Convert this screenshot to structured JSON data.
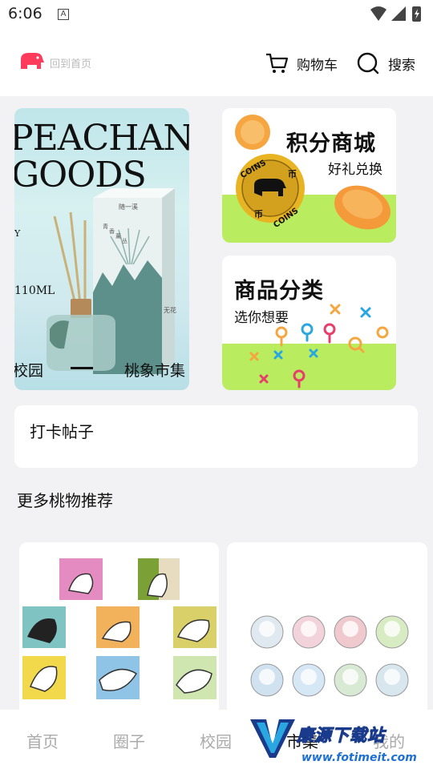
{
  "status_bar": {
    "time": "6:06",
    "notification_icon": "A"
  },
  "header": {
    "home_link": "回到首页",
    "cart_label": "购物车",
    "search_label": "搜索"
  },
  "banner": {
    "line1": "PEACHANT",
    "line2": "GOODS",
    "y_text": "Y",
    "volume": "110ML",
    "box_labels": [
      "随一溪",
      "青",
      "香",
      "薰",
      "丛",
      "无花"
    ],
    "left_caption": "校园",
    "right_caption": "桃象市集"
  },
  "points_mall": {
    "title": "积分商城",
    "subtitle": "好礼兑换",
    "coin_text_top": "COINS",
    "coin_text_bottom": "COINS",
    "coin_char": "币"
  },
  "category": {
    "title": "商品分类",
    "subtitle": "选你想要"
  },
  "checkin": {
    "label": "打卡帖子"
  },
  "recommend": {
    "title": "更多桃物推荐"
  },
  "tabs": [
    {
      "label": "首页"
    },
    {
      "label": "圈子"
    },
    {
      "label": "校园"
    },
    {
      "label": "市集"
    },
    {
      "label": "我的"
    }
  ],
  "watermark": {
    "title": "康源下载站",
    "url": "www.fotimeit.com"
  },
  "colors": {
    "accent": "#b9ec5e",
    "logo": "#ff3b5c",
    "coin": "#e8b423"
  }
}
